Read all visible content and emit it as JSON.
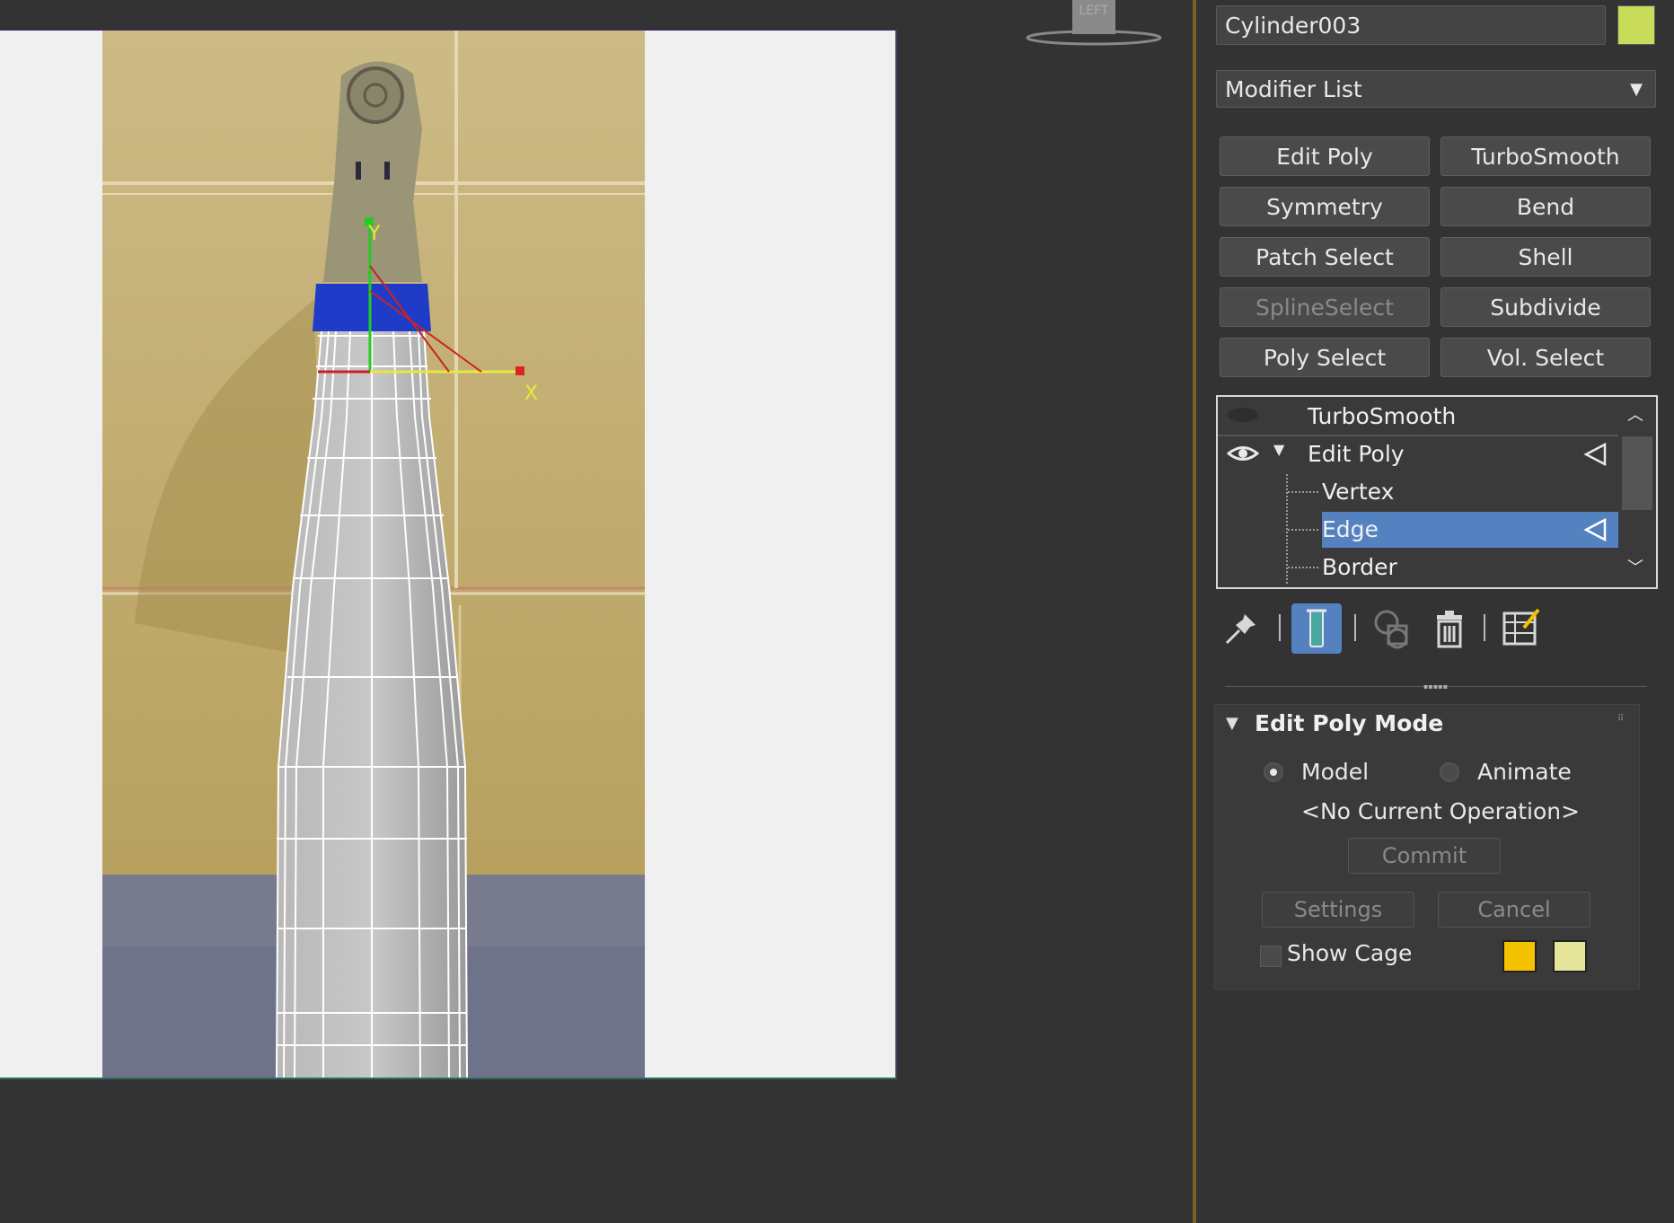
{
  "viewport": {
    "viewcube_label": "LEFT",
    "axis_labels": {
      "x": "X",
      "y": "Y"
    }
  },
  "command_panel": {
    "object_name": "Cylinder003",
    "object_color": "#c8dc5a",
    "modifier_list": "Modifier List",
    "modifier_buttons": [
      {
        "label": "Edit Poly",
        "enabled": true
      },
      {
        "label": "TurboSmooth",
        "enabled": true
      },
      {
        "label": "Symmetry",
        "enabled": true
      },
      {
        "label": "Bend",
        "enabled": true
      },
      {
        "label": "Patch Select",
        "enabled": true
      },
      {
        "label": "Shell",
        "enabled": true
      },
      {
        "label": "SplineSelect",
        "enabled": false
      },
      {
        "label": "Subdivide",
        "enabled": true
      },
      {
        "label": "Poly Select",
        "enabled": true
      },
      {
        "label": "Vol. Select",
        "enabled": true
      }
    ],
    "modifier_stack": {
      "items": [
        "TurboSmooth",
        "Edit Poly",
        "Vertex",
        "Edge",
        "Border"
      ],
      "selected": "Edge"
    },
    "toolbar_icons": [
      "pin-icon",
      "show-end-result-icon",
      "make-unique-icon",
      "remove-modifier-icon",
      "configure-modifier-sets-icon"
    ],
    "rollout": {
      "title": "Edit Poly Mode",
      "mode_options": [
        "Model",
        "Animate"
      ],
      "selected_mode": "Model",
      "operation": "<No Current Operation>",
      "commit": "Commit",
      "settings": "Settings",
      "cancel": "Cancel",
      "show_cage": "Show Cage",
      "cage_colors": [
        "#f5c200",
        "#e4e49a"
      ]
    }
  }
}
